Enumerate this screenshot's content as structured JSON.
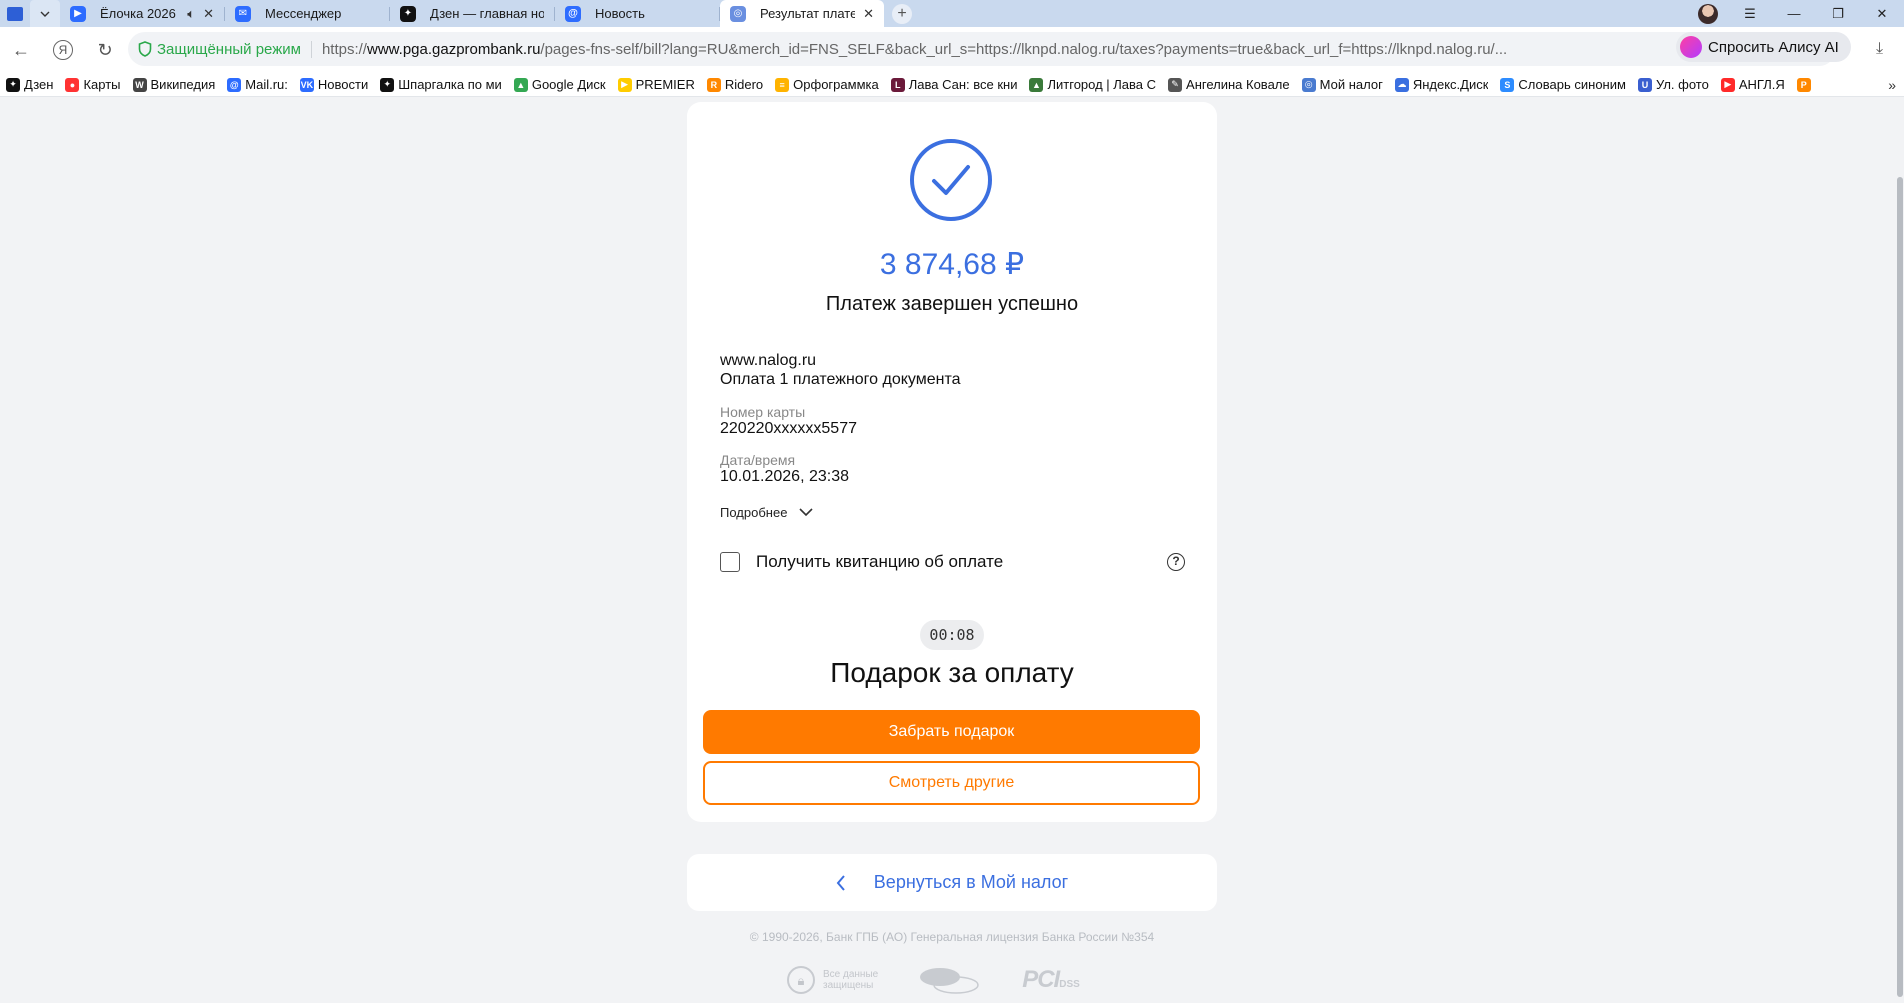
{
  "browser": {
    "tabs": [
      {
        "title": "Ёлочка 2026",
        "fav_color": "#2d6cff",
        "fav_glyph": "▶",
        "muted": true
      },
      {
        "title": "Мессенджер",
        "fav_color": "#2d6cff",
        "fav_glyph": "✉"
      },
      {
        "title": "Дзен — главная новостна",
        "fav_color": "#111111",
        "fav_glyph": "✦"
      },
      {
        "title": "Новость",
        "fav_color": "#2d6cff",
        "fav_glyph": "@"
      },
      {
        "title": "Результат платежа",
        "fav_color": "#6a8fe0",
        "fav_glyph": "◎",
        "active": true
      }
    ],
    "window_controls": {
      "menu": "☰",
      "minimize": "—",
      "restore": "❐",
      "close": "✕"
    },
    "nav": {
      "back": "←",
      "yandex": "Я",
      "reload": "↻"
    },
    "secure_label": "Защищённый режим",
    "url_prefix": "https://",
    "url_host": "www.pga.gazprombank.ru",
    "url_rest": "/pages-fns-self/bill?lang=RU&merch_id=FNS_SELF&back_url_s=https://lknpd.nalog.ru/taxes?payments=true&back_url_f=https://lknpd.nalog.ru/...",
    "alice_label": "Спросить Алису AI",
    "bookmarks": [
      {
        "label": "Дзен",
        "color": "#111111",
        "glyph": "✦"
      },
      {
        "label": "Карты",
        "color": "#ff3333",
        "glyph": "●"
      },
      {
        "label": "Википедия",
        "color": "#444444",
        "glyph": "W"
      },
      {
        "label": "Mail.ru:",
        "color": "#2d6cff",
        "glyph": "@"
      },
      {
        "label": "Новости",
        "color": "#2d6cff",
        "glyph": "VK"
      },
      {
        "label": "Шпаргалка по ми",
        "color": "#111111",
        "glyph": "✦"
      },
      {
        "label": "Google Диск",
        "color": "#34a853",
        "glyph": "▲"
      },
      {
        "label": "PREMIER",
        "color": "#ffcc00",
        "glyph": "▶"
      },
      {
        "label": "Ridero",
        "color": "#ff8800",
        "glyph": "R"
      },
      {
        "label": "Орфограммка",
        "color": "#ffb300",
        "glyph": "≡"
      },
      {
        "label": "Лава Сан: все кни",
        "color": "#6b1a3a",
        "glyph": "L"
      },
      {
        "label": "Литгород | Лава С",
        "color": "#3a7a3a",
        "glyph": "▲"
      },
      {
        "label": "Ангелина Ковале",
        "color": "#555555",
        "glyph": "✎"
      },
      {
        "label": "Мой налог",
        "color": "#4a7bd0",
        "glyph": "◎"
      },
      {
        "label": "Яндекс.Диск",
        "color": "#3a6fe0",
        "glyph": "☁"
      },
      {
        "label": "Словарь синоним",
        "color": "#2d8cff",
        "glyph": "S"
      },
      {
        "label": "Ул. фото",
        "color": "#3a5fd0",
        "glyph": "U"
      },
      {
        "label": "АНГЛ.Я",
        "color": "#ff2a2a",
        "glyph": "▶"
      },
      {
        "label": "",
        "color": "#ff8800",
        "glyph": "P"
      }
    ],
    "bookmarks_more": "»"
  },
  "payment": {
    "amount": "3 874,68 ₽",
    "status": "Платеж завершен успешно",
    "merchant": "www.nalog.ru",
    "description": "Оплата 1 платежного документа",
    "card_label": "Номер карты",
    "card_number": "220220xxxxxx5577",
    "date_label": "Дата/время",
    "date_value": "10.01.2026, 23:38",
    "details_link": "Подробнее",
    "receipt_label": "Получить квитанцию об оплате",
    "receipt_checked": false,
    "help": "?",
    "timer": "00:08",
    "gift_title": "Подарок за оплату",
    "gift_button": "Забрать подарок",
    "others_button": "Смотреть другие",
    "back_link": "Вернуться в Мой налог",
    "colors": {
      "accent_blue": "#3b6fe0",
      "orange": "#ff7a00"
    }
  },
  "footer": {
    "copyright": "© 1990-2026, Банк ГПБ (АО) Генеральная лицензия Банка России №354",
    "safe_line1": "Все данные",
    "safe_line2": "защищены",
    "pci_main": "PCI",
    "pci_sub": "DSS"
  }
}
